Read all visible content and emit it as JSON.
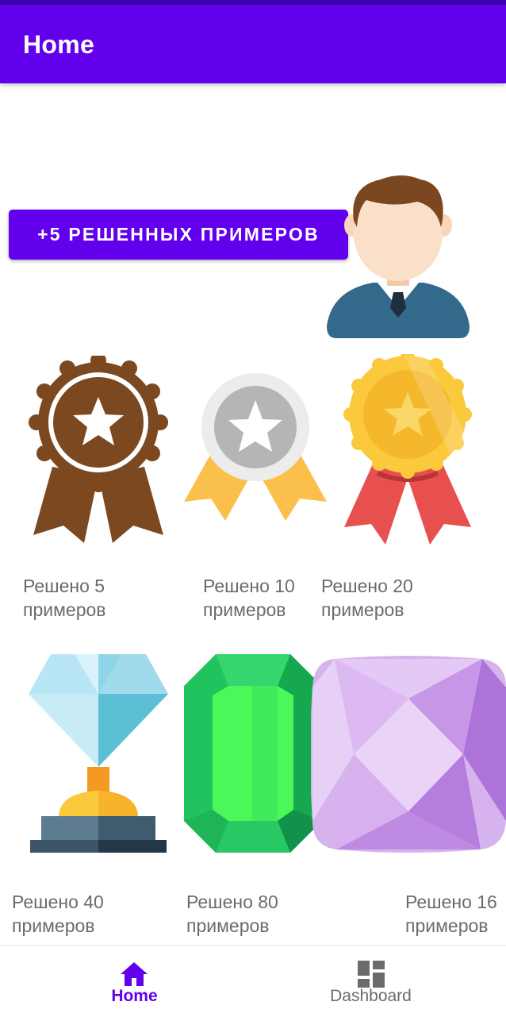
{
  "app_bar": {
    "title": "Home"
  },
  "action_button": {
    "label": "+5 РЕШЕННЫХ ПРИМЕРОВ"
  },
  "avatar": {
    "icon": "user-avatar-icon"
  },
  "achievements": [
    {
      "icon": "bronze-medal-icon",
      "line1": "Решено 5",
      "line2": "примеров"
    },
    {
      "icon": "silver-medal-icon",
      "line1": "Решено 10",
      "line2": "примеров"
    },
    {
      "icon": "gold-medal-icon",
      "line1": "Решено 20",
      "line2": "примеров"
    },
    {
      "icon": "diamond-trophy-icon",
      "line1": "Решено 40",
      "line2": "примеров"
    },
    {
      "icon": "emerald-gem-icon",
      "line1": "Решено 80",
      "line2": "примеров"
    },
    {
      "icon": "amethyst-gem-icon",
      "line1": "Решено 16",
      "line2": "примеров"
    }
  ],
  "bottom_nav": {
    "items": [
      {
        "label": "Home",
        "icon": "home-icon",
        "selected": true
      },
      {
        "label": "Dashboard",
        "icon": "dashboard-icon",
        "selected": false
      }
    ]
  },
  "colors": {
    "primary": "#6200ee",
    "status_bar": "#3a00b3",
    "caption_text": "#6b6b6b",
    "nav_inactive": "#6b6b6b"
  }
}
